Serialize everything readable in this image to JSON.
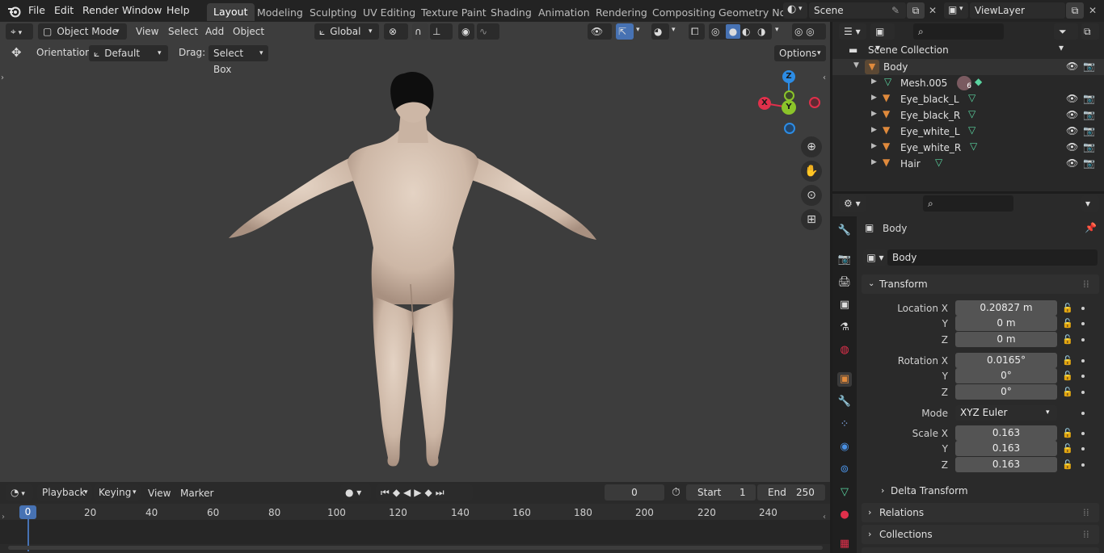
{
  "menu": [
    "File",
    "Edit",
    "Render",
    "Window",
    "Help"
  ],
  "workspaces": [
    "Layout",
    "Modeling",
    "Sculpting",
    "UV Editing",
    "Texture Paint",
    "Shading",
    "Animation",
    "Rendering",
    "Compositing",
    "Geometry Noc"
  ],
  "scene": "Scene",
  "view_layer": "ViewLayer",
  "viewport_header": {
    "mode": "Object Mode",
    "menus": [
      "View",
      "Select",
      "Add",
      "Object"
    ],
    "transform_orientation": "Global",
    "orientation_label": "Orientation:",
    "orientation_value": "Default",
    "drag_label": "Drag:",
    "drag_value": "Select Box",
    "options": "Options"
  },
  "gizmo": {
    "x": "X",
    "y": "Y",
    "z": "Z"
  },
  "timeline": {
    "menus": [
      "Playback",
      "Keying",
      "View",
      "Marker"
    ],
    "current_frame": "0",
    "start_label": "Start",
    "start_value": "1",
    "end_label": "End",
    "end_value": "250",
    "frame_marker": "0",
    "ticks": [
      "20",
      "40",
      "60",
      "80",
      "100",
      "120",
      "140",
      "160",
      "180",
      "200",
      "220",
      "240"
    ]
  },
  "outliner": {
    "root": "Scene Collection",
    "items": [
      {
        "name": "Body",
        "level": 0
      },
      {
        "name": "Mesh.005",
        "level": 1,
        "badge": "6"
      },
      {
        "name": "Eye_black_L",
        "level": 1
      },
      {
        "name": "Eye_black_R",
        "level": 1
      },
      {
        "name": "Eye_white_L",
        "level": 1
      },
      {
        "name": "Eye_white_R",
        "level": 1
      },
      {
        "name": "Hair",
        "level": 1
      }
    ]
  },
  "properties": {
    "object_name": "Body",
    "data_name": "Body",
    "transform_title": "Transform",
    "location_label": "Location X",
    "location": [
      "0.20827 m",
      "0 m",
      "0 m"
    ],
    "rotation_label": "Rotation X",
    "rotation": [
      "0.0165°",
      "0°",
      "0°"
    ],
    "mode_label": "Mode",
    "mode_value": "XYZ Euler",
    "scale_label": "Scale X",
    "scale": [
      "0.163",
      "0.163",
      "0.163"
    ],
    "axis_y": "Y",
    "axis_z": "Z",
    "delta_transform": "Delta Transform",
    "relations": "Relations",
    "collections": "Collections"
  },
  "colors": {
    "accent_active": "#4772b3",
    "object_orange": "#e08a3c",
    "mesh_green": "#5ad4a0",
    "axis_x": "#e0304b",
    "axis_y": "#8bc42a",
    "axis_z": "#2c8ce5"
  }
}
